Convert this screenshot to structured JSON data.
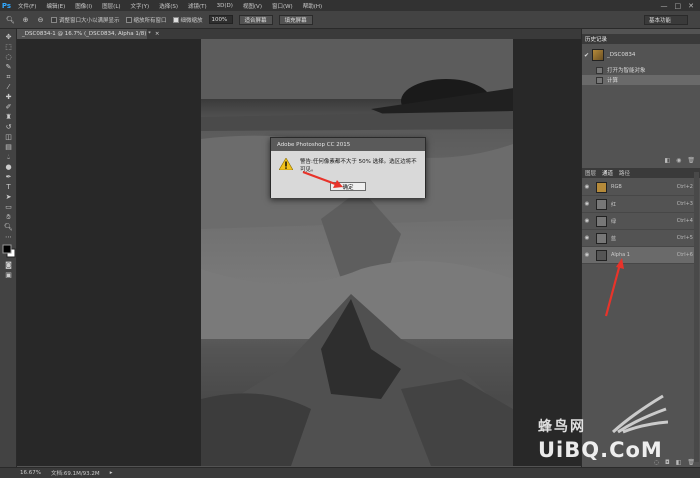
{
  "app": {
    "logo": "Ps"
  },
  "menu": [
    "文件(F)",
    "编辑(E)",
    "图像(I)",
    "图层(L)",
    "文字(Y)",
    "选择(S)",
    "滤镜(T)",
    "3D(D)",
    "视图(V)",
    "窗口(W)",
    "帮助(H)"
  ],
  "window_controls": [
    "—",
    "□",
    "✕"
  ],
  "options": {
    "resize_windows_label": "调整窗口大小以满屏显示",
    "zoom_all_label": "缩放所有窗口",
    "scrubby_zoom_label": "细微缩放",
    "zoom_value": "100%",
    "fit_screen_label": "适合屏幕",
    "fill_screen_label": "填充屏幕",
    "workspace_label": "基本功能"
  },
  "document": {
    "tab_title": "_DSC0834-1 @ 16.7% (_DSC0834, Alpha 1/8) *"
  },
  "dialog": {
    "title": "Adobe Photoshop CC 2015",
    "message": "警告:任何像素都不大于 50% 选择。选区边将不可见。",
    "ok_label": "确定"
  },
  "history_panel": {
    "title": "历史记录",
    "snapshot_label": "_DSC0834",
    "items": [
      "打开为智能对象",
      "计算"
    ],
    "selected_index": 1
  },
  "channels_panel": {
    "tabs": [
      "图层",
      "通道",
      "路径"
    ],
    "active_tab": "通道",
    "rows": [
      {
        "name": "RGB",
        "key": "Ctrl+2"
      },
      {
        "name": "红",
        "key": "Ctrl+3"
      },
      {
        "name": "绿",
        "key": "Ctrl+4"
      },
      {
        "name": "蓝",
        "key": "Ctrl+5"
      },
      {
        "name": "Alpha 1",
        "key": "Ctrl+6"
      }
    ],
    "selected_row": "Alpha 1"
  },
  "status": {
    "zoom": "16.67%",
    "doc_size": "文档:69.1M/93.2M"
  },
  "watermark": {
    "chinese": "蜂鸟网",
    "english": "UiBQ.CoM"
  },
  "colors": {
    "accent_ps": "#31a8ff",
    "annotation_arrow": "#e8332a"
  }
}
